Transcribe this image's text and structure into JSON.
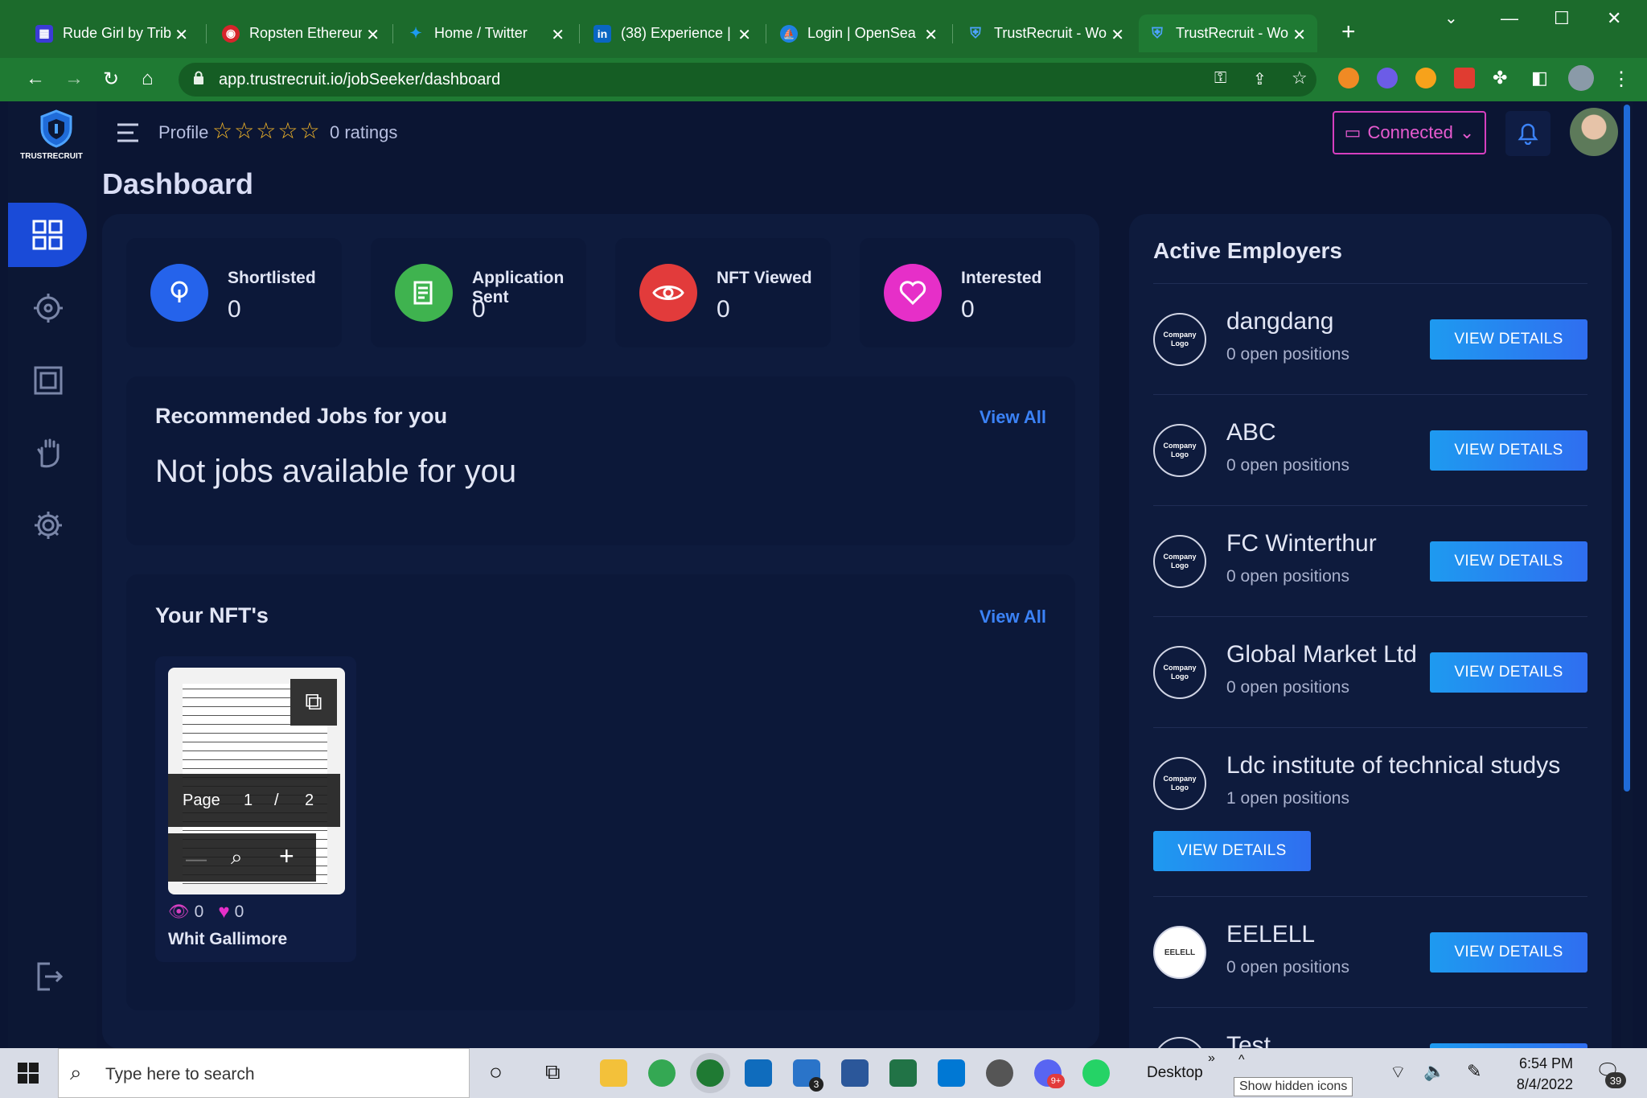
{
  "browser": {
    "tabs": [
      {
        "label": "Rude Girl by Trib",
        "color": "#3b3bd6",
        "glyph": "▦"
      },
      {
        "label": "Ropsten Ethereum",
        "color": "#d6252b",
        "glyph": "◉"
      },
      {
        "label": "Home / Twitter",
        "color": "#1d9bf0",
        "glyph": "✦"
      },
      {
        "label": "(38) Experience |",
        "color": "#0a66c2",
        "glyph": "in"
      },
      {
        "label": "Login | OpenSea",
        "color": "#2081e2",
        "glyph": "⛵"
      },
      {
        "label": "TrustRecruit - Wo",
        "color": "#1f6bd8",
        "glyph": "⛨"
      },
      {
        "label": "TrustRecruit - Wo",
        "color": "#1f6bd8",
        "glyph": "⛨"
      }
    ],
    "url": "app.trustrecruit.io/jobSeeker/dashboard"
  },
  "brand": {
    "logo_text": "TRUSTRECRUIT"
  },
  "header": {
    "profile_label": "Profile",
    "ratings_text": "0 ratings",
    "connected_label": "Connected"
  },
  "page": {
    "title": "Dashboard"
  },
  "stats": [
    {
      "label": "Shortlisted",
      "value": "0",
      "color": "#2563eb"
    },
    {
      "label": "Application Sent",
      "value": "0",
      "color": "#3fb34f"
    },
    {
      "label": "NFT Viewed",
      "value": "0",
      "color": "#e23b3b"
    },
    {
      "label": "Interested",
      "value": "0",
      "color": "#e62fc8"
    }
  ],
  "recommended": {
    "title": "Recommended Jobs for you",
    "view_all": "View All",
    "empty": "Not jobs available for you"
  },
  "nfts": {
    "title": "Your NFT's",
    "view_all": "View All",
    "item": {
      "page_label": "Page",
      "page_current": "1",
      "page_sep": "/",
      "page_total": "2",
      "views": "0",
      "likes": "0",
      "name": "Whit Gallimore"
    }
  },
  "employers": {
    "title": "Active Employers",
    "logo_placeholder": "Company Logo",
    "button_label": "VIEW DETAILS",
    "items": [
      {
        "name": "dangdang",
        "positions": "0 open positions"
      },
      {
        "name": "ABC",
        "positions": "0 open positions"
      },
      {
        "name": "FC Winterthur",
        "positions": "0 open positions"
      },
      {
        "name": "Global Market Ltd",
        "positions": "0 open positions"
      },
      {
        "name": "Ldc institute of technical studys",
        "positions": "1 open positions"
      },
      {
        "name": "EELELL",
        "positions": "0 open positions",
        "logo_text": "EELELL"
      },
      {
        "name": "Test",
        "positions": ""
      }
    ]
  },
  "taskbar": {
    "search_placeholder": "Type here to search",
    "desktop_label": "Desktop",
    "hidden_icons_tooltip": "Show hidden icons",
    "time": "6:54 PM",
    "date": "8/4/2022",
    "notif_count": "39",
    "mail_badge": "3",
    "discord_badge": "9+"
  }
}
